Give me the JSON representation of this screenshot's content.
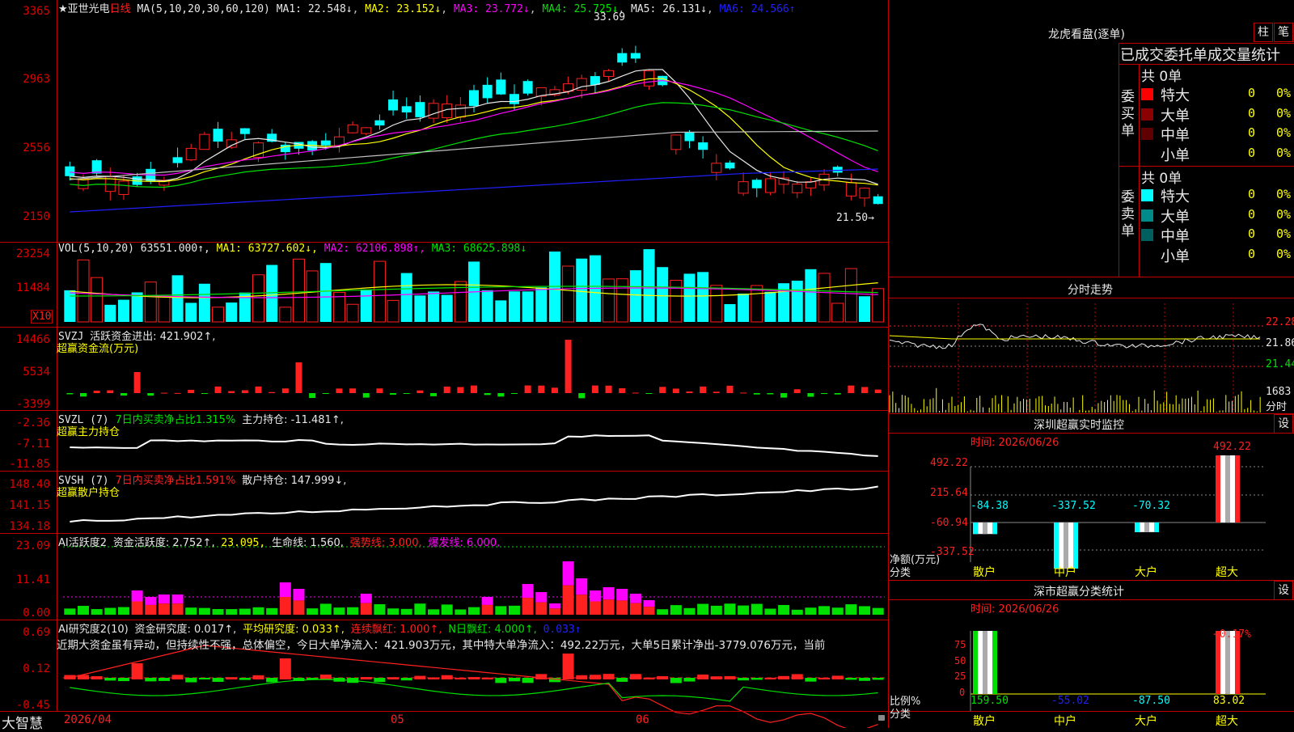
{
  "colors": {
    "up": "#ff2020",
    "down": "#00ffff",
    "grid": "#c00000",
    "ma1": "#e8e8e8",
    "ma2": "#ffff00",
    "ma3": "#ff00ff",
    "ma4": "#00e000",
    "ma5": "#c0c0c0",
    "ma6": "#2020ff"
  },
  "main": {
    "legend": {
      "star": "★亚世光电",
      "period": "日线",
      "ma_def": "MA(5,10,20,30,60,120)",
      "ma1": "MA1: 22.548↓",
      "ma2": "MA2: 23.152↓",
      "ma3": "MA3: 23.772↓",
      "ma4": "MA4: 25.725↓",
      "ma5": "MA5: 26.131↓",
      "ma6": "MA6: 24.566↑"
    },
    "y_labels": [
      "3365",
      "2963",
      "2556",
      "2150"
    ],
    "high_label": "33.69",
    "low_label": "21.50→"
  },
  "vol": {
    "legend": {
      "name": "VOL(5,10,20)",
      "val": "63551.000↑,",
      "ma1": "MA1: 63727.602↓,",
      "ma2": "MA2: 62106.898↑,",
      "ma3": "MA3: 68625.898↓"
    },
    "y_labels": [
      "23254",
      "11484"
    ],
    "unit": "X10"
  },
  "svzj": {
    "legend": {
      "name": "SVZJ",
      "label": "活跃资金进出: 421.902↑,",
      "sub": "超赢资金流(万元)"
    },
    "y_labels": [
      "14466",
      "5534",
      "-3399"
    ]
  },
  "svzl": {
    "legend": {
      "name": "SVZL (7)",
      "label1": "7日内买卖净占比1.315%",
      "label2": "主力持仓: -11.481↑,",
      "sub": "超赢主力持仓"
    },
    "y_labels": [
      "-2.36",
      "-7.11",
      "-11.85"
    ]
  },
  "svsh": {
    "legend": {
      "name": "SVSH (7)",
      "label1": "7日内买卖净占比1.591%",
      "label2": "散户持仓: 147.999↓,",
      "sub": "超赢散户持仓"
    },
    "y_labels": [
      "148.40",
      "141.15",
      "134.18"
    ]
  },
  "ai1": {
    "legend": {
      "name": "AI活跃度2",
      "a": "资金活跃度: 2.752↑,",
      "b": "23.095,",
      "c": "生命线: 1.560,",
      "d": "强势线: 3.000,",
      "e": "爆发线: 6.000,"
    },
    "y_labels": [
      "23.09",
      "11.41",
      "0.00"
    ]
  },
  "ai2": {
    "legend": {
      "name": "AI研究度2(10)",
      "a": "资金研究度: 0.017↑,",
      "b": "平均研究度: 0.033↑,",
      "c": "连续飘红: 1.000↑,",
      "d": "N日飘红: 4.000↑,",
      "e": "0.033↑"
    },
    "comment": "近期大资金虽有异动，但持续性不强，总体偏空，今日大单净流入：421.903万元，其中特大单净流入：492.22万元，大单5日累计净出-3779.076万元，当前",
    "y_labels": [
      "0.69",
      "0.12",
      "-0.45"
    ]
  },
  "bottom": {
    "app": "大智慧",
    "dates": [
      "2026/04",
      "05",
      "06"
    ]
  },
  "right": {
    "lhb": {
      "title": "龙虎看盘(逐单)",
      "btn1": "柱",
      "btn2": "笔",
      "tabs": "已成交委托单成交量统计",
      "buy": {
        "side": "委买单",
        "total": "共 0单",
        "rows": [
          {
            "label": "特大",
            "n": "0",
            "p": "0%",
            "color": "#ff0000"
          },
          {
            "label": "大单",
            "n": "0",
            "p": "0%",
            "color": "#8b0000"
          },
          {
            "label": "中单",
            "n": "0",
            "p": "0%",
            "color": "#600000"
          },
          {
            "label": "小单",
            "n": "0",
            "p": "0%",
            "color": "#000000"
          }
        ]
      },
      "sell": {
        "side": "委卖单",
        "total": "共 0单",
        "rows": [
          {
            "label": "特大",
            "n": "0",
            "p": "0%",
            "color": "#00ffff"
          },
          {
            "label": "大单",
            "n": "0",
            "p": "0%",
            "color": "#008b8b"
          },
          {
            "label": "中单",
            "n": "0",
            "p": "0%",
            "color": "#006060"
          },
          {
            "label": "小单",
            "n": "0",
            "p": "0%",
            "color": "#000000"
          }
        ]
      }
    },
    "fenshi": {
      "title": "分时走势",
      "y_labels": [
        "22.28",
        "21.86",
        "21.44"
      ],
      "vol_label": "1683",
      "unit": "分时"
    },
    "monitor": {
      "title": "深圳超赢实时监控",
      "btn": "设",
      "date": "时间: 2026/06/26",
      "y_labels": [
        "492.22",
        "215.64",
        "-60.94",
        "-337.52"
      ],
      "axis_name": "净额(万元)",
      "axis_name2": "分类",
      "cats": [
        "散户",
        "中户",
        "大户",
        "超大"
      ],
      "values": [
        -84.38,
        -337.52,
        -70.32,
        492.22
      ],
      "value_labels": [
        "-84.38",
        "-337.52",
        "-70.32",
        "492.22"
      ]
    },
    "classify": {
      "title": "深市超赢分类统计",
      "btn": "设",
      "date": "时间: 2026/06/26",
      "y_labels": [
        "75",
        "50",
        "25",
        "0"
      ],
      "top_label": "+0.17%",
      "axis_name": "比例%",
      "axis_name2": "分类",
      "cats": [
        "散户",
        "中户",
        "大户",
        "超大"
      ],
      "values": [
        "159.50",
        "-55.02",
        "-87.50",
        "83.02"
      ]
    }
  }
}
